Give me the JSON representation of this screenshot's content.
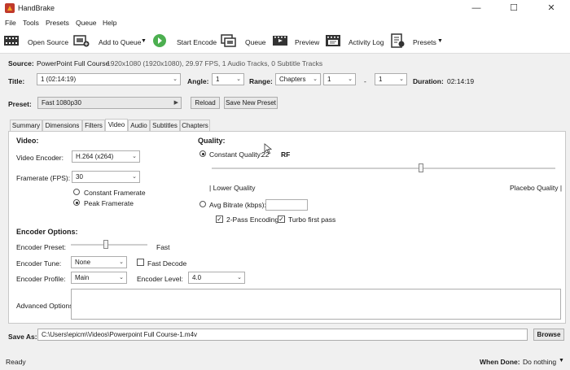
{
  "window": {
    "title": "HandBrake",
    "min": "—",
    "max": "☐",
    "close": "✕"
  },
  "menu": [
    "File",
    "Tools",
    "Presets",
    "Queue",
    "Help"
  ],
  "toolbar": {
    "open_source": "Open Source",
    "add_to_queue": "Add to Queue",
    "start_encode": "Start Encode",
    "queue": "Queue",
    "preview": "Preview",
    "activity_log": "Activity Log",
    "presets": "Presets"
  },
  "source": {
    "label": "Source:",
    "name": "PowerPoint Full Course",
    "info": "1920x1080 (1920x1080), 29.97 FPS, 1 Audio Tracks, 0 Subtitle Tracks"
  },
  "title_row": {
    "title_label": "Title:",
    "title_value": "1 (02:14:19)",
    "angle_label": "Angle:",
    "angle_value": "1",
    "range_label": "Range:",
    "range_type": "Chapters",
    "range_start": "1",
    "range_sep": "-",
    "range_end": "1",
    "duration_label": "Duration:",
    "duration_value": "02:14:19"
  },
  "preset": {
    "label": "Preset:",
    "value": "Fast 1080p30",
    "reload": "Reload",
    "save_new": "Save New Preset"
  },
  "tabs": [
    "Summary",
    "Dimensions",
    "Filters",
    "Video",
    "Audio",
    "Subtitles",
    "Chapters"
  ],
  "video": {
    "heading": "Video:",
    "encoder_label": "Video Encoder:",
    "encoder_value": "H.264 (x264)",
    "framerate_label": "Framerate (FPS):",
    "framerate_value": "30",
    "constant_framerate": "Constant Framerate",
    "peak_framerate": "Peak Framerate"
  },
  "quality": {
    "heading": "Quality:",
    "constant_quality": "Constant Quality:",
    "cq_value": "22",
    "rf": "RF",
    "lower_quality": "| Lower Quality",
    "placebo_quality": "Placebo Quality |",
    "avg_bitrate": "Avg Bitrate (kbps):",
    "two_pass": "2-Pass Encoding",
    "turbo": "Turbo first pass",
    "slider_level": 0.61
  },
  "encoder_options": {
    "heading": "Encoder Options:",
    "preset_label": "Encoder Preset:",
    "preset_value": "Fast",
    "tune_label": "Encoder Tune:",
    "tune_value": "None",
    "fast_decode": "Fast Decode",
    "profile_label": "Encoder Profile:",
    "profile_value": "Main",
    "level_label": "Encoder Level:",
    "level_value": "4.0",
    "advanced_label": "Advanced Options:"
  },
  "save_as": {
    "label": "Save As:",
    "path": "C:\\Users\\epicm\\Videos\\Powerpoint Full Course-1.m4v",
    "browse": "Browse"
  },
  "status": {
    "text": "Ready",
    "when_done_label": "When Done:",
    "when_done_value": "Do nothing"
  }
}
